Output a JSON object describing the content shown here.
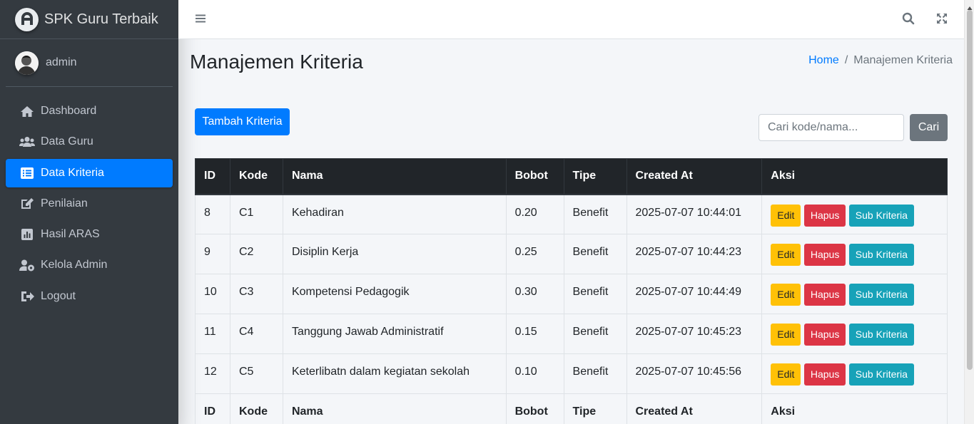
{
  "brand": {
    "name": "SPK Guru Terbaik"
  },
  "user": {
    "name": "admin"
  },
  "sidebar": {
    "items": [
      {
        "label": "Dashboard",
        "icon": "home-icon",
        "active": false
      },
      {
        "label": "Data Guru",
        "icon": "users-icon",
        "active": false
      },
      {
        "label": "Data Kriteria",
        "icon": "list-icon",
        "active": true
      },
      {
        "label": "Penilaian",
        "icon": "edit-icon",
        "active": false
      },
      {
        "label": "Hasil ARAS",
        "icon": "chart-icon",
        "active": false
      },
      {
        "label": "Kelola Admin",
        "icon": "user-cog-icon",
        "active": false
      },
      {
        "label": "Logout",
        "icon": "sign-out-icon",
        "active": false
      }
    ]
  },
  "navbar": {
    "icons": [
      "bars-icon",
      "search-icon",
      "expand-icon"
    ]
  },
  "page": {
    "title": "Manajemen Kriteria",
    "breadcrumb": {
      "home": "Home",
      "separator": "/",
      "current": "Manajemen Kriteria"
    }
  },
  "toolbar": {
    "add_label": "Tambah Kriteria",
    "search_placeholder": "Cari kode/nama...",
    "search_button": "Cari"
  },
  "table": {
    "headers": [
      "ID",
      "Kode",
      "Nama",
      "Bobot",
      "Tipe",
      "Created At",
      "Aksi"
    ],
    "rows": [
      {
        "id": "8",
        "kode": "C1",
        "nama": "Kehadiran",
        "bobot": "0.20",
        "tipe": "Benefit",
        "created_at": "2025-07-07 10:44:01"
      },
      {
        "id": "9",
        "kode": "C2",
        "nama": "Disiplin Kerja",
        "bobot": "0.25",
        "tipe": "Benefit",
        "created_at": "2025-07-07 10:44:23"
      },
      {
        "id": "10",
        "kode": "C3",
        "nama": "Kompetensi Pedagogik",
        "bobot": "0.30",
        "tipe": "Benefit",
        "created_at": "2025-07-07 10:44:49"
      },
      {
        "id": "11",
        "kode": "C4",
        "nama": "Tanggung Jawab Administratif",
        "bobot": "0.15",
        "tipe": "Benefit",
        "created_at": "2025-07-07 10:45:23"
      },
      {
        "id": "12",
        "kode": "C5",
        "nama": "Keterlibatn dalam kegiatan sekolah",
        "bobot": "0.10",
        "tipe": "Benefit",
        "created_at": "2025-07-07 10:45:56"
      }
    ],
    "actions": {
      "edit": "Edit",
      "delete": "Hapus",
      "sub": "Sub Kriteria"
    }
  },
  "colors": {
    "sidebar_bg": "#343a40",
    "primary": "#007bff",
    "secondary": "#6c757d",
    "warning": "#ffc107",
    "danger": "#dc3545",
    "info": "#17a2b8",
    "table_head": "#212529"
  }
}
